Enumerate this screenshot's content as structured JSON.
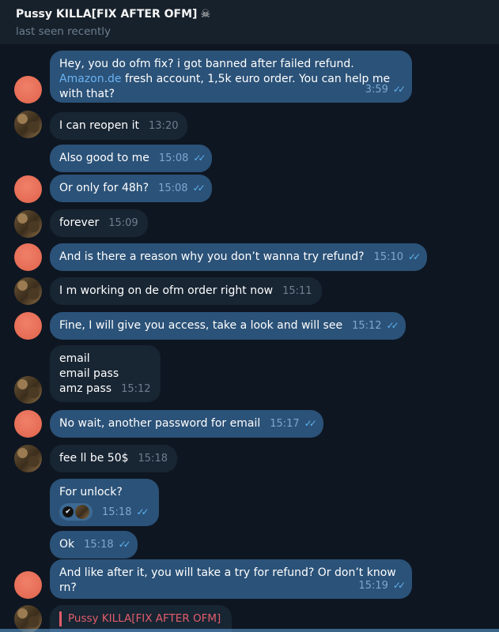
{
  "header": {
    "title": "Pussy KILLA[FIX AFTER OFM]",
    "title_icon": "skull-icon",
    "status": "last seen recently"
  },
  "messages": [
    {
      "from": "me",
      "text_before": "Hey, you do ofm fix? i got banned after failed refund. ",
      "link": "Amazon.de",
      "text_after": "fresh account, 1,5k euro order. You can help me with that?",
      "time": "3:59",
      "read": true
    },
    {
      "from": "them",
      "text": "I can reopen it",
      "time": "13:20"
    },
    {
      "from": "me",
      "text": "Also good to me",
      "time": "15:08",
      "read": true
    },
    {
      "from": "me",
      "text": "Or only for 48h?",
      "time": "15:08",
      "read": true
    },
    {
      "from": "them",
      "text": "forever",
      "time": "15:09"
    },
    {
      "from": "me",
      "text": "And is there a reason why you don’t wanna try refund?",
      "time": "15:10",
      "read": true
    },
    {
      "from": "them",
      "text": "I m working on de ofm order right now",
      "time": "15:11"
    },
    {
      "from": "me",
      "text": "Fine, I will give you access, take a look and will see",
      "time": "15:12",
      "read": true
    },
    {
      "from": "them",
      "lines": [
        "email",
        "email pass",
        "amz pass"
      ],
      "time": "15:12"
    },
    {
      "from": "me",
      "text": "No wait, another password for email",
      "time": "15:17",
      "read": true
    },
    {
      "from": "them",
      "text": "fee ll be 50$",
      "time": "15:18"
    },
    {
      "from": "me",
      "text": "For unlock?",
      "time": "15:18",
      "read": true,
      "reaction": "✔"
    },
    {
      "from": "me",
      "text": "Ok",
      "time": "15:18",
      "read": true
    },
    {
      "from": "me",
      "text": "And like after it, you will take a try for refund? Or don’t know rn?",
      "time": "15:19",
      "read": true
    },
    {
      "from": "them",
      "reply_to": "Pussy KILLA[FIX AFTER OFM]"
    }
  ],
  "colors": {
    "background": "#0e1621",
    "outgoing_bubble": "#2b5278",
    "incoming_bubble": "#182533",
    "link": "#6ab3f3",
    "reply_accent": "#e35d6a"
  }
}
